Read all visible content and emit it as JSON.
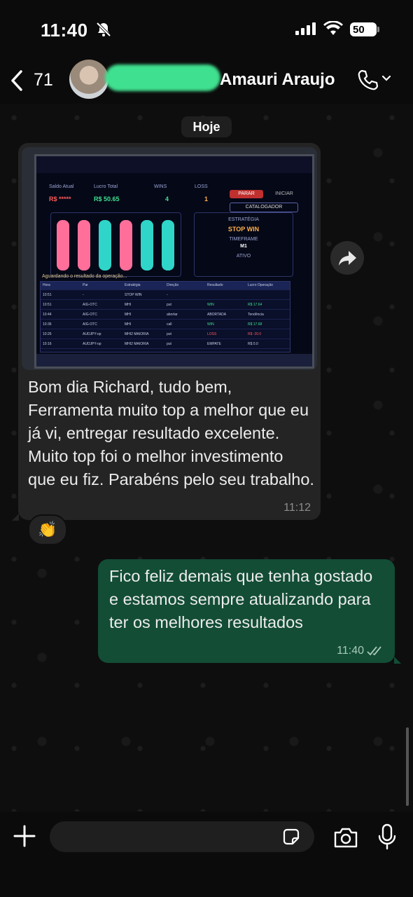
{
  "status_bar": {
    "time": "11:40",
    "battery": "50"
  },
  "header": {
    "back_count": "71",
    "contact_name": "Amauri Araujo"
  },
  "chat": {
    "date_chip": "Hoje",
    "incoming": {
      "text": "Bom dia Richard, tudo bem, Ferramenta muito top a melhor que eu já vi, entregar resultado excelente. Muito top foi o melhor investimento que eu fiz. Parabéns pelo seu trabalho.",
      "time": "11:12",
      "reaction": "👏",
      "photo": {
        "saldo_label": "Saldo Atual",
        "saldo_value": "R$ *****",
        "lucro_label": "Lucro Total",
        "lucro_value": "R$ 50.65",
        "wins_label": "WINS",
        "wins_value": "4",
        "loss_label": "LOSS",
        "loss_value": "1",
        "btn_parar": "PARAR",
        "btn_iniciar": "INICIAR",
        "btn_catalogador": "CATALOGADOR",
        "strategy_label": "ESTRATÉGIA",
        "strategy_value": "STOP WIN",
        "timeframe_label": "TIMEFRAME",
        "timeframe_value": "M1",
        "ativo_label": "ATIVO",
        "waiting_text": "Aguardando o resultado da operação...",
        "table_headers": [
          "Hora",
          "Par",
          "Estratégia",
          "Direção",
          "Resultado",
          "Lucro Operação"
        ],
        "rows": [
          [
            "10:51",
            "-",
            "STOP WIN",
            "-",
            "",
            ""
          ],
          [
            "10:51",
            "AIG-OTC",
            "MHI",
            "put",
            "WIN",
            "R$ 17.64"
          ],
          [
            "10:44",
            "AIG-OTC",
            "MHI",
            "abortar",
            "ABORTADA",
            "Tendência"
          ],
          [
            "10:36",
            "AIG-OTC",
            "MHI",
            "call",
            "WIN",
            "R$ 17.68"
          ],
          [
            "10:26",
            "AUDJPY-op",
            "MHI2 MAIORIA",
            "put",
            "LOSS",
            "R$ -20.0"
          ],
          [
            "10:16",
            "AUDJPY-op",
            "MHI2 MAIORIA",
            "put",
            "EMPATE",
            "R$ 0.0"
          ]
        ]
      }
    },
    "outgoing": {
      "text": "Fico feliz demais que tenha gostado e estamos sempre atualizando para ter os melhores resultados",
      "time": "11:40"
    }
  },
  "composer": {
    "placeholder": ""
  },
  "colors": {
    "incoming_bubble": "#242424",
    "outgoing_bubble": "#134d36",
    "accent_green": "#3fe08f"
  },
  "icons": [
    "bell-slash-icon",
    "signal-icon",
    "wifi-icon",
    "back-chevron-icon",
    "phone-icon",
    "chevron-down-icon",
    "forward-icon",
    "double-check-icon",
    "plus-icon",
    "sticker-icon",
    "camera-icon",
    "mic-icon"
  ]
}
